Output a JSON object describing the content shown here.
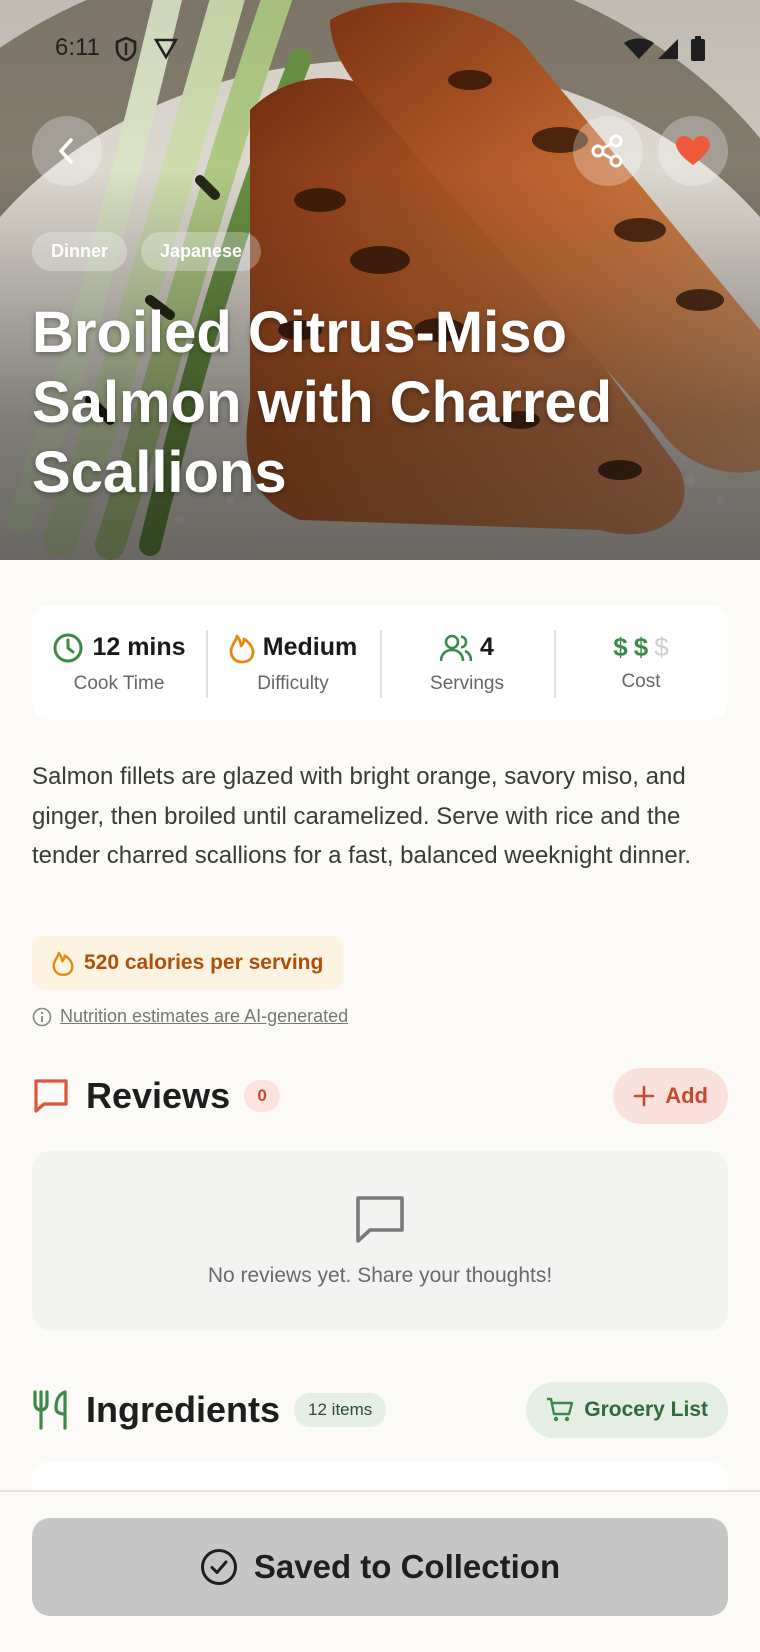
{
  "status_bar": {
    "time": "6:11"
  },
  "hero": {
    "tags": [
      "Dinner",
      "Japanese"
    ],
    "title": "Broiled Citrus-Miso Salmon with Charred Scallions",
    "favorite_color": "#f05a3c"
  },
  "stats": {
    "cook_time": {
      "value": "12 mins",
      "label": "Cook Time"
    },
    "difficulty": {
      "value": "Medium",
      "label": "Difficulty"
    },
    "servings": {
      "value": "4",
      "label": "Servings"
    },
    "cost": {
      "symbols": [
        "$",
        "$",
        "$"
      ],
      "active_count": 2,
      "label": "Cost"
    }
  },
  "description": "Salmon fillets are glazed with bright orange, savory miso, and ginger, then broiled until caramelized. Serve with rice and the tender charred scallions for a fast, balanced weeknight dinner.",
  "calories": "520 calories per serving",
  "nutrition_note": "Nutrition estimates are AI-generated",
  "reviews": {
    "title": "Reviews",
    "count": "0",
    "add_label": "Add",
    "empty_text": "No reviews yet. Share your thoughts!"
  },
  "ingredients": {
    "title": "Ingredients",
    "count": "12 items",
    "grocery_label": "Grocery List"
  },
  "footer": {
    "save_label": "Saved to Collection"
  },
  "colors": {
    "accent_green": "#3c8a4a",
    "accent_orange": "#e8890f",
    "reviews_red": "#e0553a",
    "save_button": "#c6c6c6"
  }
}
